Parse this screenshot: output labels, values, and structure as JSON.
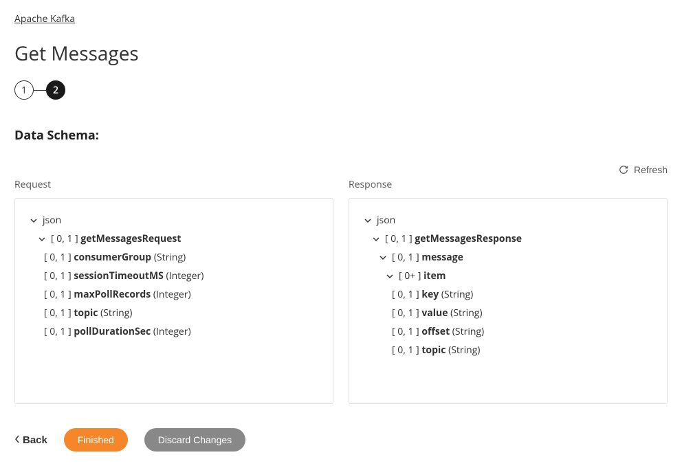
{
  "breadcrumb": {
    "label": "Apache Kafka"
  },
  "page_title": "Get Messages",
  "stepper": {
    "step1": "1",
    "step2": "2"
  },
  "section_title": "Data Schema:",
  "refresh_label": "Refresh",
  "columns": {
    "request_label": "Request",
    "response_label": "Response"
  },
  "request_tree": {
    "root": "json",
    "n1_card": "[ 0, 1 ]",
    "n1_name": "getMessagesRequest",
    "f1_card": "[ 0, 1 ]",
    "f1_name": "consumerGroup",
    "f1_type": "(String)",
    "f2_card": "[ 0, 1 ]",
    "f2_name": "sessionTimeoutMS",
    "f2_type": "(Integer)",
    "f3_card": "[ 0, 1 ]",
    "f3_name": "maxPollRecords",
    "f3_type": "(Integer)",
    "f4_card": "[ 0, 1 ]",
    "f4_name": "topic",
    "f4_type": "(String)",
    "f5_card": "[ 0, 1 ]",
    "f5_name": "pollDurationSec",
    "f5_type": "(Integer)"
  },
  "response_tree": {
    "root": "json",
    "n1_card": "[ 0, 1 ]",
    "n1_name": "getMessagesResponse",
    "n2_card": "[ 0, 1 ]",
    "n2_name": "message",
    "n3_card": "[ 0+ ]",
    "n3_name": "item",
    "f1_card": "[ 0, 1 ]",
    "f1_name": "key",
    "f1_type": "(String)",
    "f2_card": "[ 0, 1 ]",
    "f2_name": "value",
    "f2_type": "(String)",
    "f3_card": "[ 0, 1 ]",
    "f3_name": "offset",
    "f3_type": "(String)",
    "f4_card": "[ 0, 1 ]",
    "f4_name": "topic",
    "f4_type": "(String)"
  },
  "footer": {
    "back": "Back",
    "finished": "Finished",
    "discard": "Discard Changes"
  }
}
